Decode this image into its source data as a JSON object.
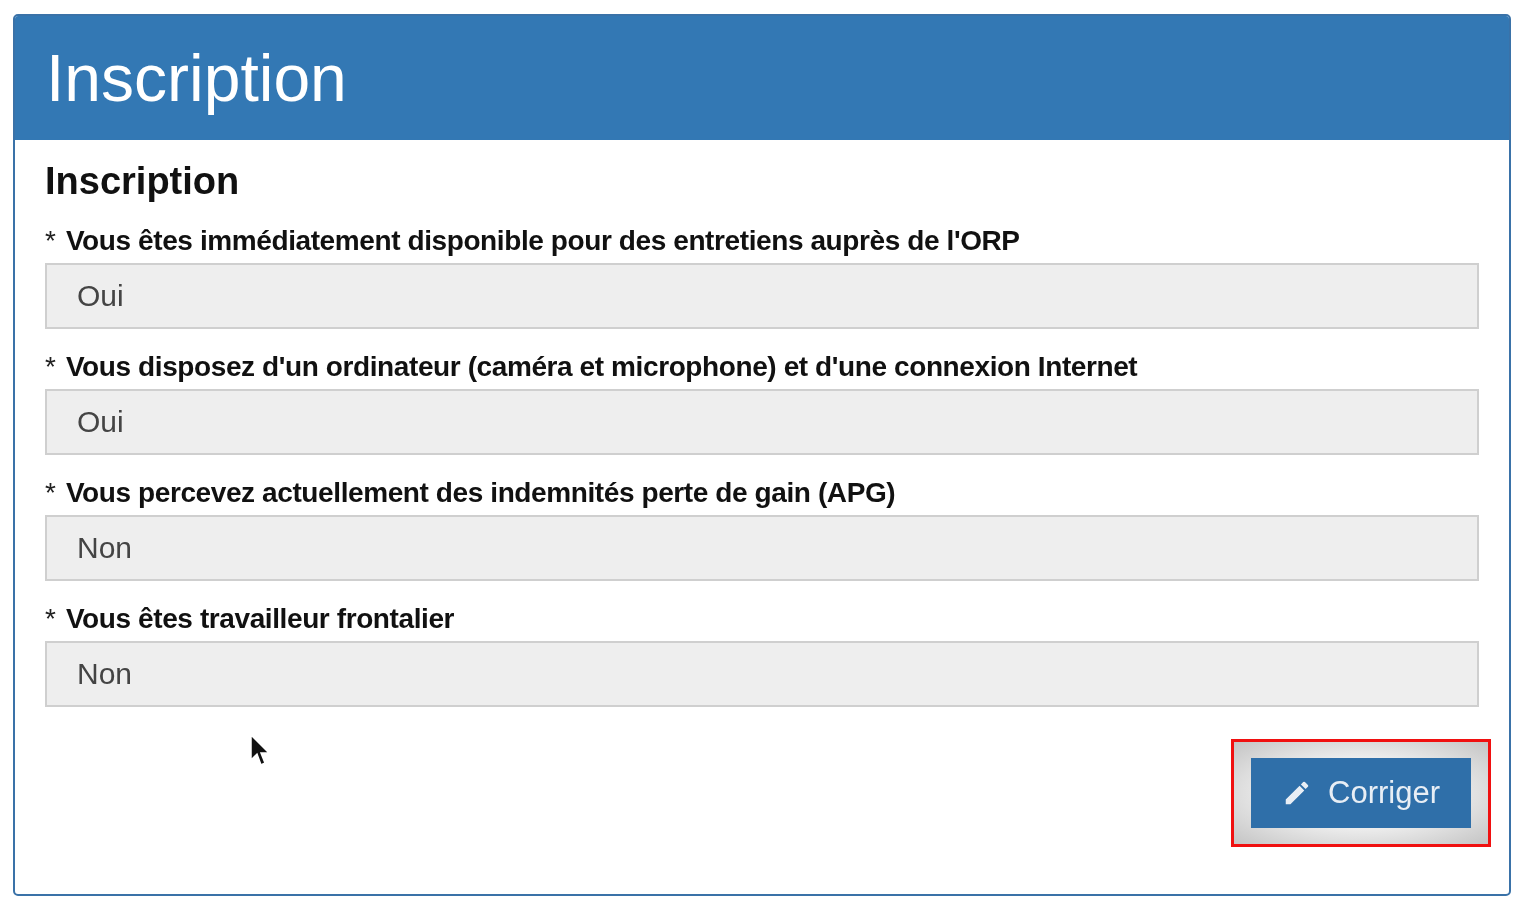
{
  "header": {
    "title": "Inscription"
  },
  "section": {
    "title": "Inscription"
  },
  "fields": [
    {
      "marker": "*",
      "label": "Vous êtes immédiatement disponible pour des entretiens auprès de l'ORP",
      "value": "Oui"
    },
    {
      "marker": "*",
      "label": "Vous disposez d'un ordinateur (caméra et microphone) et d'une connexion Internet",
      "value": "Oui"
    },
    {
      "marker": "*",
      "label": "Vous percevez actuellement des indemnités perte de gain (APG)",
      "value": "Non"
    },
    {
      "marker": "*",
      "label": "Vous êtes travailleur frontalier",
      "value": "Non"
    }
  ],
  "button": {
    "label": "Corriger",
    "highlighted": true
  }
}
